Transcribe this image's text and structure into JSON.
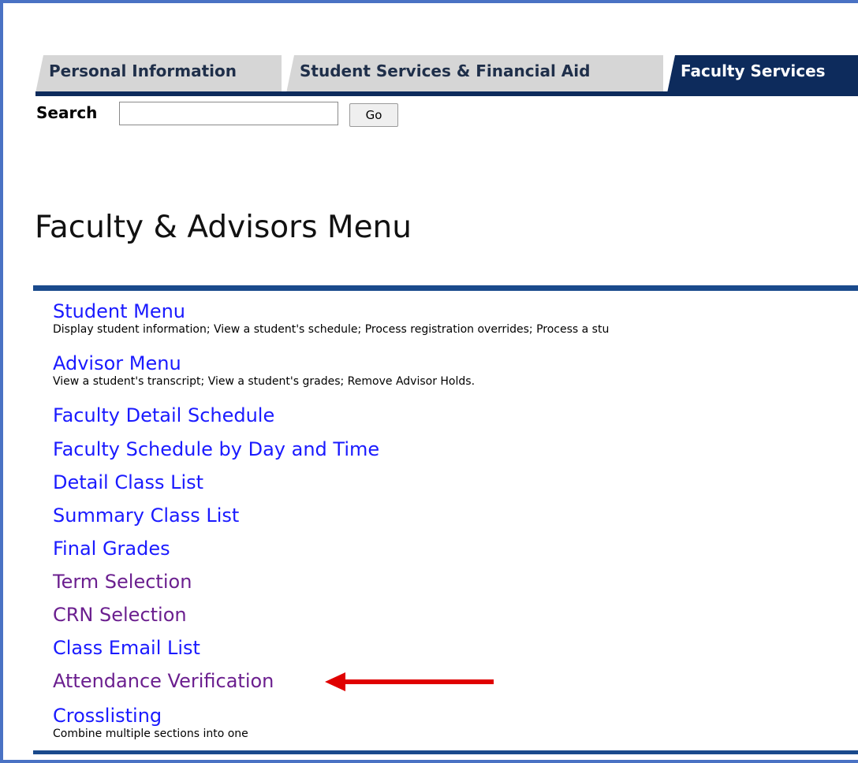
{
  "tabs": [
    {
      "label": "Personal Information",
      "active": false
    },
    {
      "label": "Student Services & Financial Aid",
      "active": false
    },
    {
      "label": "Faculty Services",
      "active": true
    }
  ],
  "search": {
    "label": "Search",
    "value": "",
    "placeholder": "",
    "button_label": "Go"
  },
  "page_title": "Faculty & Advisors Menu",
  "menu": [
    {
      "label": "Student Menu",
      "description": "Display student information; View a student's schedule; Process registration overrides; Process a stu",
      "visited": false
    },
    {
      "label": "Advisor Menu",
      "description": "View a student's transcript; View a student's grades; Remove Advisor Holds.",
      "visited": false
    },
    {
      "label": "Faculty Detail Schedule",
      "description": "",
      "visited": false
    },
    {
      "label": "Faculty Schedule by Day and Time",
      "description": "",
      "visited": false
    },
    {
      "label": "Detail Class List",
      "description": "",
      "visited": false
    },
    {
      "label": "Summary Class List",
      "description": "",
      "visited": false
    },
    {
      "label": "Final Grades",
      "description": "",
      "visited": false
    },
    {
      "label": "Term Selection",
      "description": "",
      "visited": true
    },
    {
      "label": "CRN Selection",
      "description": "",
      "visited": true
    },
    {
      "label": "Class Email List",
      "description": "",
      "visited": false
    },
    {
      "label": "Attendance Verification",
      "description": "",
      "visited": true
    },
    {
      "label": "Crosslisting",
      "description": "Combine multiple sections into one",
      "visited": false
    }
  ],
  "colors": {
    "tab_active_bg": "#0d2b5c",
    "tab_inactive_bg": "#d6d6d6",
    "link": "#1a1aff",
    "link_visited": "#6b1f8f",
    "rule": "#1a4a8c",
    "arrow": "#e00000"
  },
  "annotation": {
    "arrow_icon": "red-arrow-icon",
    "points_to": "Attendance Verification"
  }
}
